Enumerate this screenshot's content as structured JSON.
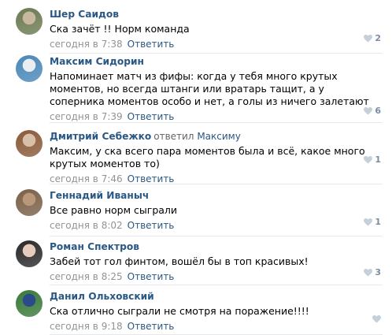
{
  "reply_label": "Ответить",
  "colors": {
    "link": "#2a5885",
    "meta": "#939393",
    "like_icon": "#c5d0db",
    "separator": "#e7e8ec"
  },
  "comments": [
    {
      "author": "Шер Саидов",
      "reply_prefix": "",
      "reply_name": "",
      "text": "Ска зачёт !! Норм команда",
      "time": "сегодня в 7:38",
      "likes": "2",
      "avatar_colors": [
        "#6b7b52",
        "#c8b8a0"
      ]
    },
    {
      "author": "Максим Сидорин",
      "reply_prefix": "",
      "reply_name": "",
      "text": "Напоминает матч из фифы: когда у тебя много крутых моментов, но всегда штанги или вратарь тащит, а у соперника моментов особо и нет, а голы из ничего залетают",
      "time": "сегодня в 7:39",
      "likes": "6",
      "avatar_colors": [
        "#4a88b8",
        "#e8eef2"
      ]
    },
    {
      "author": "Дмитрий Себежко",
      "reply_prefix": "ответил",
      "reply_name": "Максиму",
      "text": "Максим, у ска всего пара моментов была и всё, какое много крутых моментов то)",
      "time": "сегодня в 7:46",
      "likes": "1",
      "avatar_colors": [
        "#8a5a3a",
        "#d8c0a8"
      ]
    },
    {
      "author": "Геннадий Иваныч",
      "reply_prefix": "",
      "reply_name": "",
      "text": "Все равно норм сыграли",
      "time": "сегодня в 8:02",
      "likes": "1",
      "avatar_colors": [
        "#7a6048",
        "#b89878"
      ]
    },
    {
      "author": "Роман Спектров",
      "reply_prefix": "",
      "reply_name": "",
      "text": "Забей тот гол финтом, вошёл бы в топ красивых!",
      "time": "сегодня в 8:25",
      "likes": "3",
      "avatar_colors": [
        "#2a2a2a",
        "#e6ccbc"
      ]
    },
    {
      "author": "Данил Ольховский",
      "reply_prefix": "",
      "reply_name": "",
      "text": "Ска отлично сыграли не смотря на поражение!!!!",
      "time": "сегодня в 9:18",
      "likes": "",
      "avatar_colors": [
        "#3a7a3a",
        "#2a4a8a"
      ]
    }
  ]
}
